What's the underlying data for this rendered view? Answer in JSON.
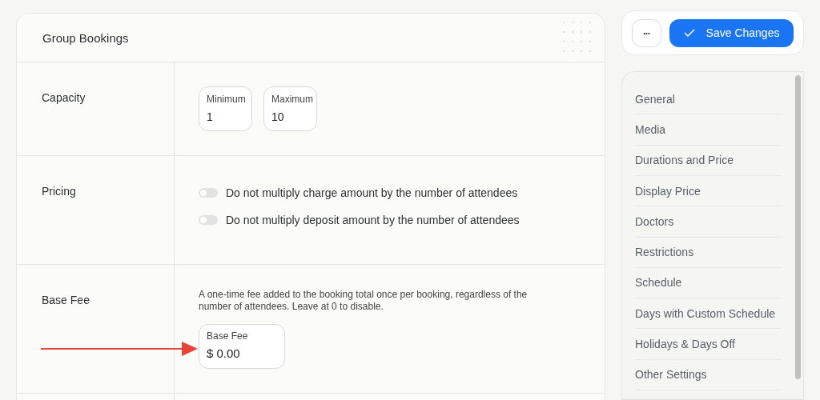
{
  "panel": {
    "title": "Group Bookings"
  },
  "capacity": {
    "label": "Capacity",
    "fields": [
      {
        "label": "Minimum",
        "value": "1"
      },
      {
        "label": "Maximum",
        "value": "10"
      }
    ]
  },
  "pricing": {
    "label": "Pricing",
    "toggles": [
      {
        "label": "Do not multiply charge amount by the number of attendees",
        "on": false
      },
      {
        "label": "Do not multiply deposit amount by the number of attendees",
        "on": false
      }
    ]
  },
  "base_fee": {
    "label": "Base Fee",
    "description": "A one-time fee added to the booking total once per booking, regardless of the number of attendees. Leave at 0 to disable.",
    "field": {
      "label": "Base Fee",
      "value": "$ 0.00"
    }
  },
  "actions": {
    "more": "•••",
    "save": "Save Changes"
  },
  "sidebar": {
    "items": [
      "General",
      "Media",
      "Durations and Price",
      "Display Price",
      "Doctors",
      "Restrictions",
      "Schedule",
      "Days with Custom Schedule",
      "Holidays & Days Off",
      "Other Settings"
    ]
  }
}
